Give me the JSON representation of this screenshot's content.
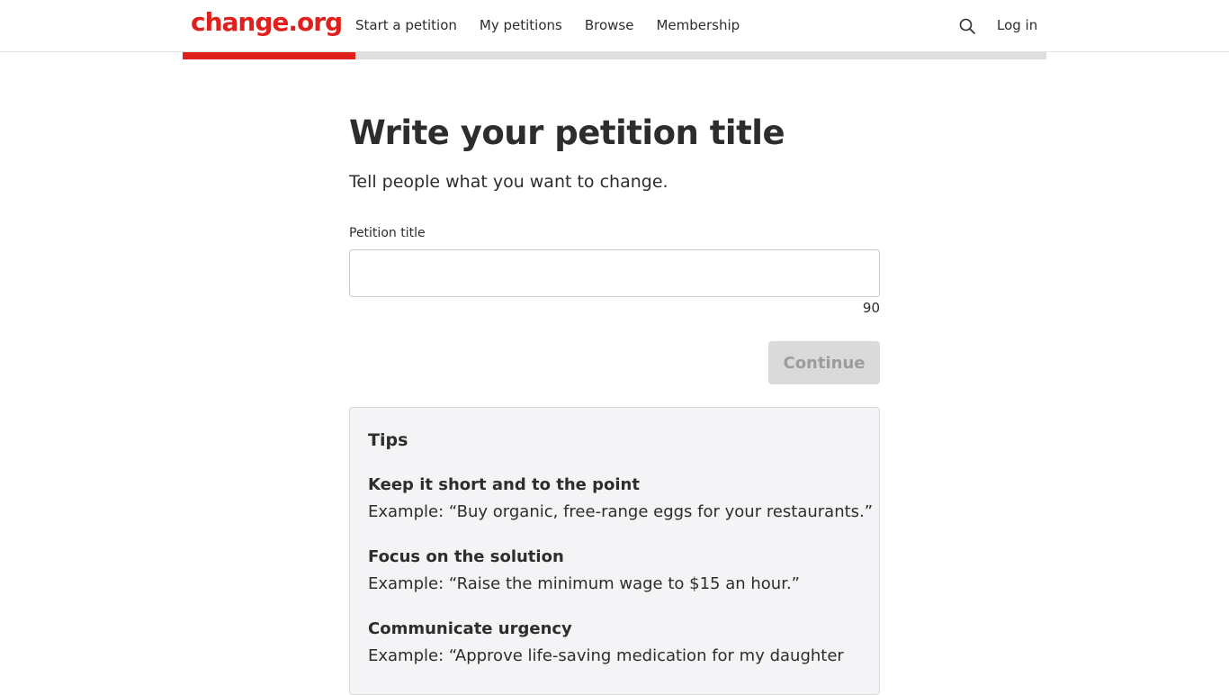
{
  "header": {
    "logo": "change.org",
    "nav": [
      {
        "label": "Start a petition"
      },
      {
        "label": "My petitions"
      },
      {
        "label": "Browse"
      },
      {
        "label": "Membership"
      }
    ],
    "search_icon": "search-icon",
    "login_label": "Log in"
  },
  "progress": {
    "fraction": 0.2,
    "fill_color": "#e0201c",
    "track_color": "#dedede"
  },
  "form": {
    "title": "Write your petition title",
    "subtitle": "Tell people what you want to change.",
    "field_label": "Petition title",
    "input_value": "",
    "char_count": "90",
    "continue_label": "Continue"
  },
  "tips": {
    "heading": "Tips",
    "items": [
      {
        "title": "Keep it short and to the point",
        "example": "Example: “Buy organic, free-range eggs for your restaurants.”"
      },
      {
        "title": "Focus on the solution",
        "example": "Example: “Raise the minimum wage to $15 an hour.”"
      },
      {
        "title": "Communicate urgency",
        "example": "Example: “Approve life-saving medication for my daughter"
      }
    ]
  },
  "colors": {
    "brand": "#e0201c",
    "text": "#2d2d2d",
    "button_disabled_bg": "#dadada",
    "button_disabled_text": "#9c9c9c",
    "tips_bg": "#f4f3f5"
  }
}
